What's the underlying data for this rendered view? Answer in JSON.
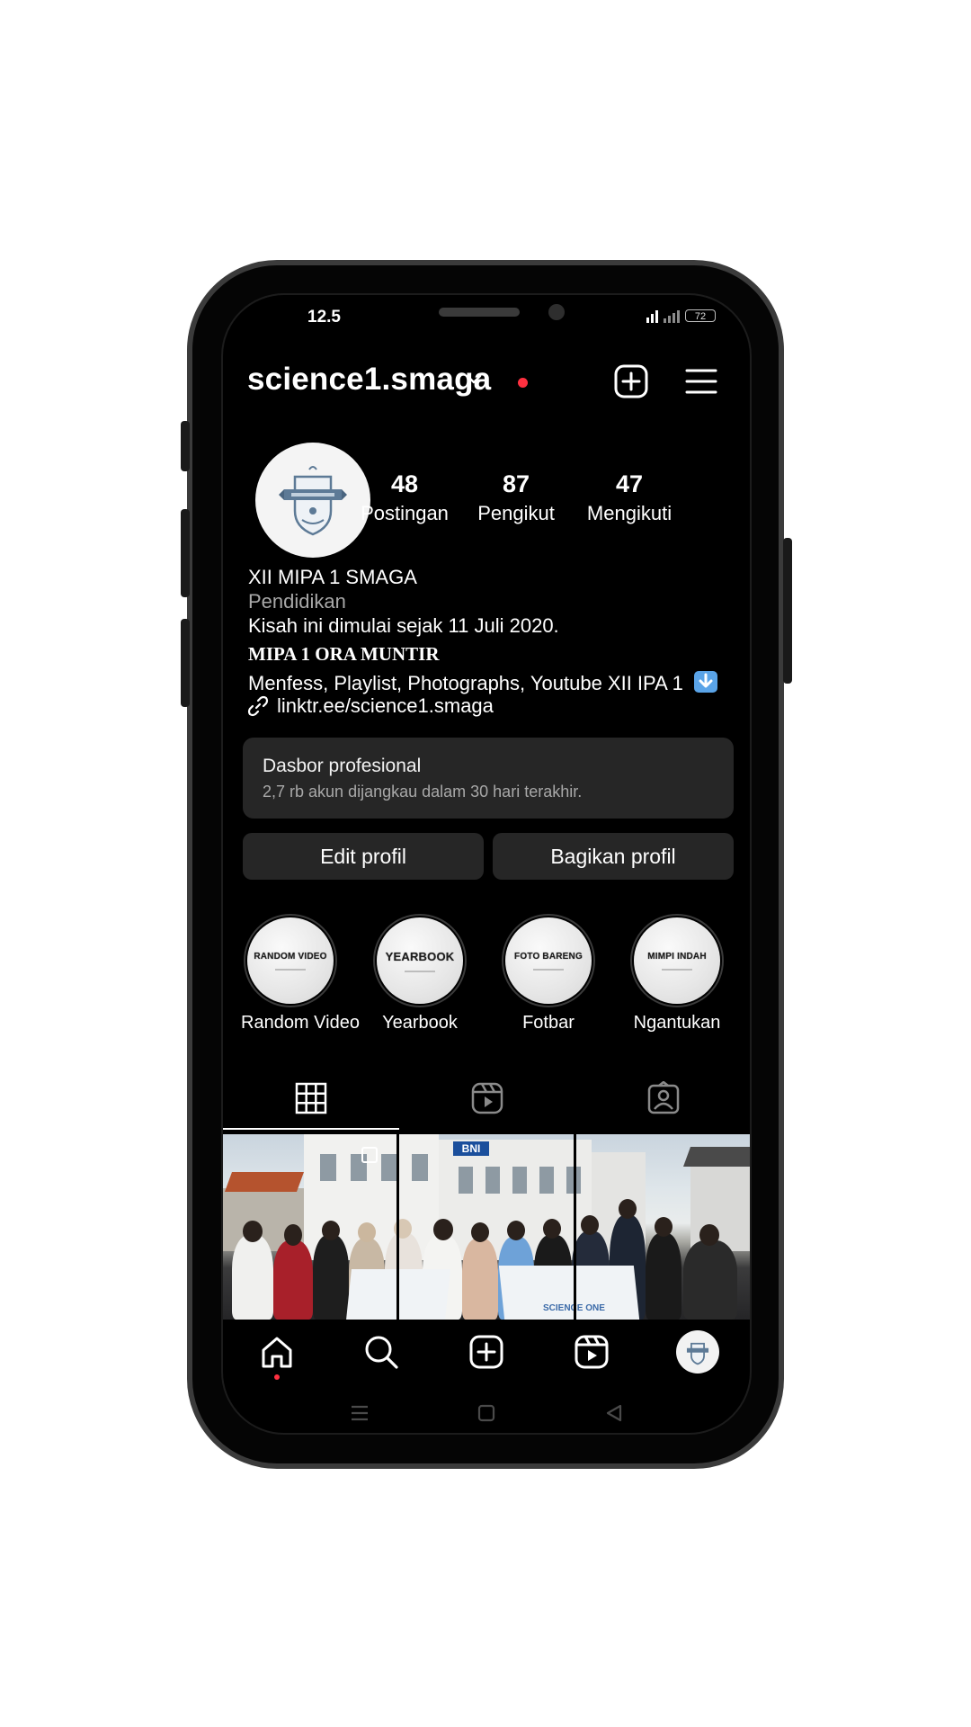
{
  "status_bar": {
    "time": "12.5",
    "battery": "72"
  },
  "profile": {
    "username": "science1.smaga",
    "stats": [
      {
        "value": "48",
        "label": "Postingan"
      },
      {
        "value": "87",
        "label": "Pengikut"
      },
      {
        "value": "47",
        "label": "Mengikuti"
      }
    ],
    "bio": {
      "name": "XII MIPA 1 SMAGA",
      "category": "Pendidikan",
      "line1": "Kisah ini dimulai sejak 11 Juli 2020.",
      "line2": "MIPA 1 ORA MUNTIR",
      "line3": "Menfess, Playlist, Photographs, Youtube XII IPA 1",
      "link": "linktr.ee/science1.smaga"
    }
  },
  "dashboard": {
    "title": "Dasbor profesional",
    "subtitle": "2,7 rb akun dijangkau dalam 30 hari terakhir."
  },
  "buttons": {
    "edit": "Edit profil",
    "share": "Bagikan profil"
  },
  "highlights": [
    {
      "cover": "RANDOM VIDEO",
      "label": "Random Video"
    },
    {
      "cover": "YEARBOOK",
      "label": "Yearbook"
    },
    {
      "cover": "FOTO BARENG",
      "label": "Fotbar"
    },
    {
      "cover": "MIMPI INDAH",
      "label": "Ngantukan"
    }
  ],
  "photo_text": {
    "sign": "BNI",
    "banner": "SCIENCE ONE"
  },
  "icons": {
    "tabs": [
      "grid-icon",
      "reels-icon",
      "tagged-icon"
    ],
    "nav": [
      "home-icon",
      "search-icon",
      "create-icon",
      "reels-icon",
      "profile-avatar"
    ]
  },
  "colors": {
    "accent_red": "#ff3040",
    "card_bg": "#262626",
    "muted_text": "#a8a8a8"
  }
}
